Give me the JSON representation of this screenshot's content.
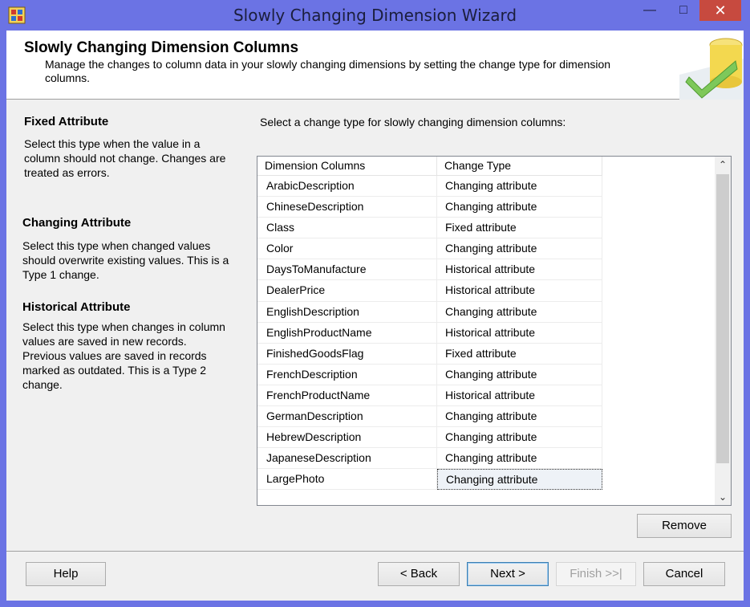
{
  "window": {
    "title": "Slowly Changing Dimension Wizard",
    "minimize_glyph": "—",
    "maximize_glyph": "□",
    "close_glyph": "✕"
  },
  "header": {
    "title": "Slowly Changing Dimension Columns",
    "description": "Manage the changes to column data in your slowly changing dimensions by setting the change type for dimension columns."
  },
  "help_panel": {
    "sections": [
      {
        "heading": "Fixed Attribute",
        "text": "Select this type when the value in a column should not change. Changes are treated as errors."
      },
      {
        "heading": "Changing Attribute",
        "text": "Select this type when changed values should overwrite existing values. This is a Type 1 change."
      },
      {
        "heading": "Historical Attribute",
        "text": "Select this type when changes in column values are saved in new records. Previous values are saved in records marked as outdated. This is a Type 2 change."
      }
    ]
  },
  "grid": {
    "prompt": "Select a change type for slowly changing dimension columns:",
    "columns": [
      "Dimension Columns",
      "Change Type"
    ],
    "rows": [
      {
        "name": "ArabicDescription",
        "type": "Changing attribute"
      },
      {
        "name": "ChineseDescription",
        "type": "Changing attribute"
      },
      {
        "name": "Class",
        "type": "Fixed attribute"
      },
      {
        "name": "Color",
        "type": "Changing attribute"
      },
      {
        "name": "DaysToManufacture",
        "type": "Historical attribute"
      },
      {
        "name": "DealerPrice",
        "type": "Historical attribute"
      },
      {
        "name": "EnglishDescription",
        "type": "Changing attribute"
      },
      {
        "name": "EnglishProductName",
        "type": "Historical attribute"
      },
      {
        "name": "FinishedGoodsFlag",
        "type": "Fixed attribute"
      },
      {
        "name": "FrenchDescription",
        "type": "Changing attribute"
      },
      {
        "name": "FrenchProductName",
        "type": "Historical attribute"
      },
      {
        "name": "GermanDescription",
        "type": "Changing attribute"
      },
      {
        "name": "HebrewDescription",
        "type": "Changing attribute"
      },
      {
        "name": "JapaneseDescription",
        "type": "Changing attribute"
      },
      {
        "name": "LargePhoto",
        "type": "Changing attribute",
        "selected": true
      }
    ]
  },
  "buttons": {
    "remove": "Remove",
    "help": "Help",
    "back": "< Back",
    "next": "Next >",
    "finish": "Finish >>|",
    "cancel": "Cancel"
  },
  "icons": {
    "app": "wizard-app-icon",
    "header_art": "database-check-icon",
    "scroll_up": "chevron-up-icon",
    "scroll_down": "chevron-down-icon"
  },
  "colors": {
    "titlebar": "#6b73e4",
    "close_button": "#c74a3f",
    "dialog_background": "#f0f0f0"
  }
}
